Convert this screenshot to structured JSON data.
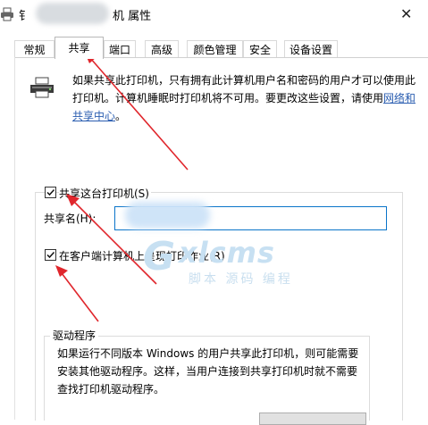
{
  "titlebar": {
    "title_head": "钅",
    "title_tail": "机 属性",
    "close_symbol": "✕"
  },
  "tabs": [
    {
      "label": "常规",
      "active": false
    },
    {
      "label": "共享",
      "active": true
    },
    {
      "label": "端口",
      "active": false
    },
    {
      "label": "高级",
      "active": false
    },
    {
      "label": "颜色管理",
      "active": false
    },
    {
      "label": "安全",
      "active": false
    },
    {
      "label": "设备设置",
      "active": false
    }
  ],
  "share": {
    "description": "如果共享此打印机，只有拥有此计算机用户名和密码的用户才可以使用此打印机。计算机睡眠时打印机将不可用。要更改这些设置，请使用",
    "link_text": "网络和共享中心",
    "link_suffix": "。",
    "share_checkbox_label": "共享这台打印机(S)",
    "share_checked": true,
    "share_name_label": "共享名(H):",
    "share_name_value": "",
    "render_checkbox_label": "在客户端计算机上呈现打印作业(R)",
    "render_checked": true
  },
  "drivers": {
    "legend": "驱动程序",
    "text": "如果运行不同版本 Windows 的用户共享此打印机，则可能需要安装其他驱动程序。这样，当用户连接到共享打印机时就不需要查找打印机驱动程序。"
  },
  "watermark": {
    "logo_g": "G",
    "logo_text": "xlcms",
    "tagline": "脚本 源码 编程"
  },
  "colors": {
    "annotation_arrow": "#e0262c",
    "link": "#2a5db0",
    "input_border": "#0a74c9"
  }
}
